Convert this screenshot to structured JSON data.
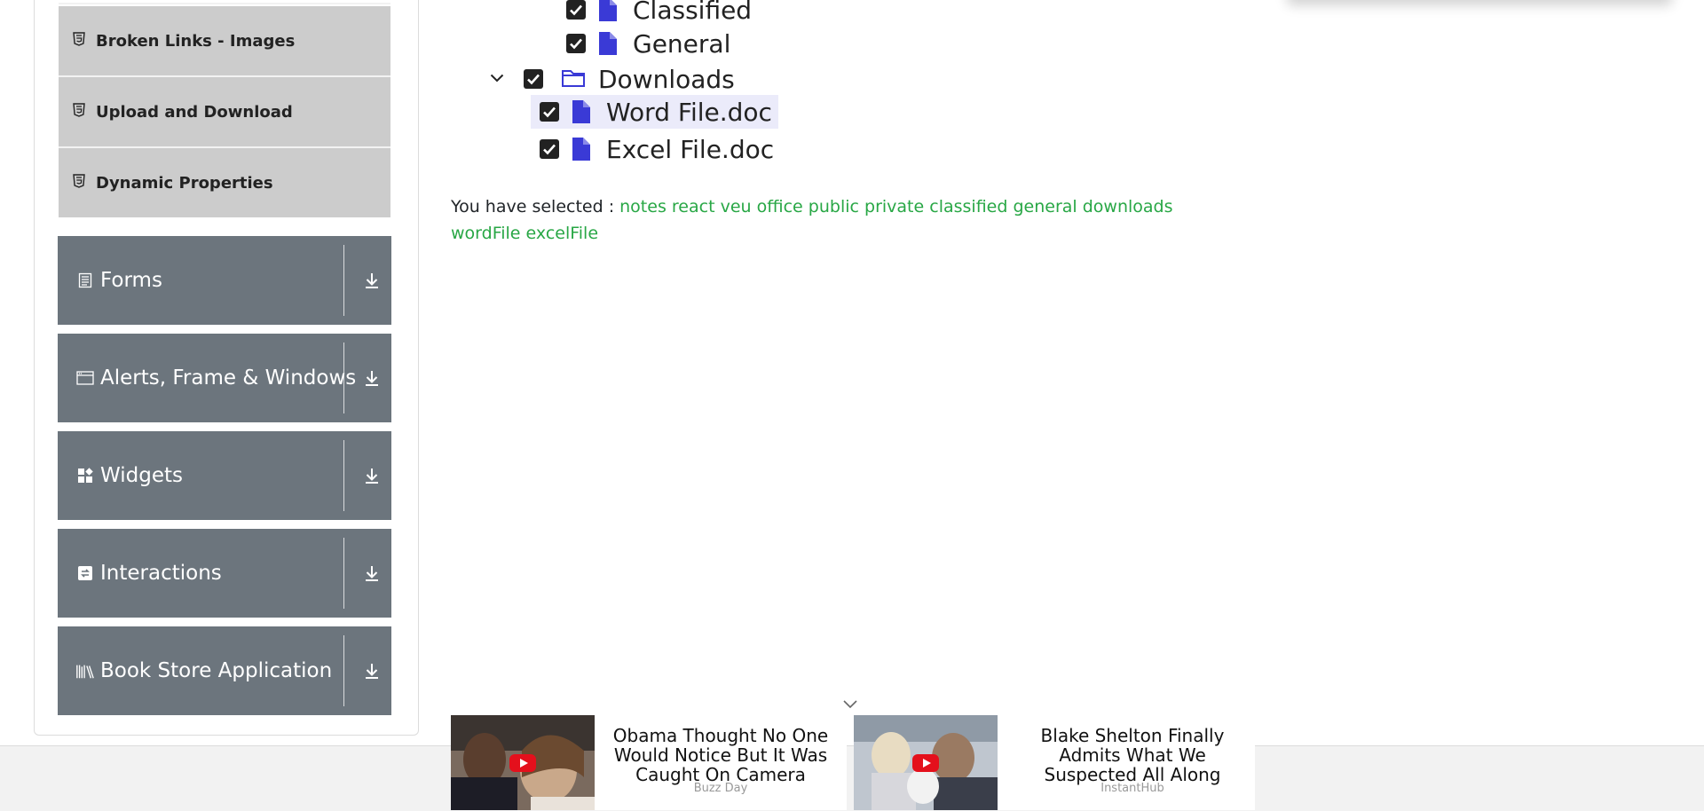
{
  "sidebar": {
    "element_items": [
      {
        "label": "Broken Links - Images",
        "icon": "html5-icon"
      },
      {
        "label": "Upload and Download",
        "icon": "html5-icon"
      },
      {
        "label": "Dynamic Properties",
        "icon": "html5-icon"
      }
    ],
    "groups": [
      {
        "label": "Forms",
        "icon": "form-icon"
      },
      {
        "label": "Alerts, Frame & Windows",
        "icon": "window-icon"
      },
      {
        "label": "Widgets",
        "icon": "widgets-icon"
      },
      {
        "label": "Interactions",
        "icon": "interactions-icon"
      },
      {
        "label": "Book Store Application",
        "icon": "books-icon"
      }
    ]
  },
  "tree": {
    "nodes": [
      {
        "label": "Classified",
        "type": "file",
        "checked": true
      },
      {
        "label": "General",
        "type": "file",
        "checked": true
      },
      {
        "label": "Downloads",
        "type": "folder",
        "checked": true,
        "expanded": true
      },
      {
        "label": "Word File.doc",
        "type": "file",
        "checked": true,
        "highlighted": true
      },
      {
        "label": "Excel File.doc",
        "type": "file",
        "checked": true
      }
    ]
  },
  "result": {
    "prefix": "You have selected :",
    "selected": [
      "notes",
      "react",
      "veu",
      "office",
      "public",
      "private",
      "classified",
      "general",
      "downloads",
      "wordFile",
      "excelFile"
    ]
  },
  "ads": [
    {
      "headline": "Obama Thought No One Would Notice But It Was Caught On Camera",
      "source": "Buzz Day"
    },
    {
      "headline": "Blake Shelton Finally Admits What We Suspected All Along",
      "source": "InstantHub"
    }
  ],
  "colors": {
    "group_bg": "#6c757d",
    "sub_item_bg": "#cccccc",
    "selected_text": "#28a745",
    "icon_blue": "#3a3ad6",
    "highlight_row": "#ebebfa"
  }
}
